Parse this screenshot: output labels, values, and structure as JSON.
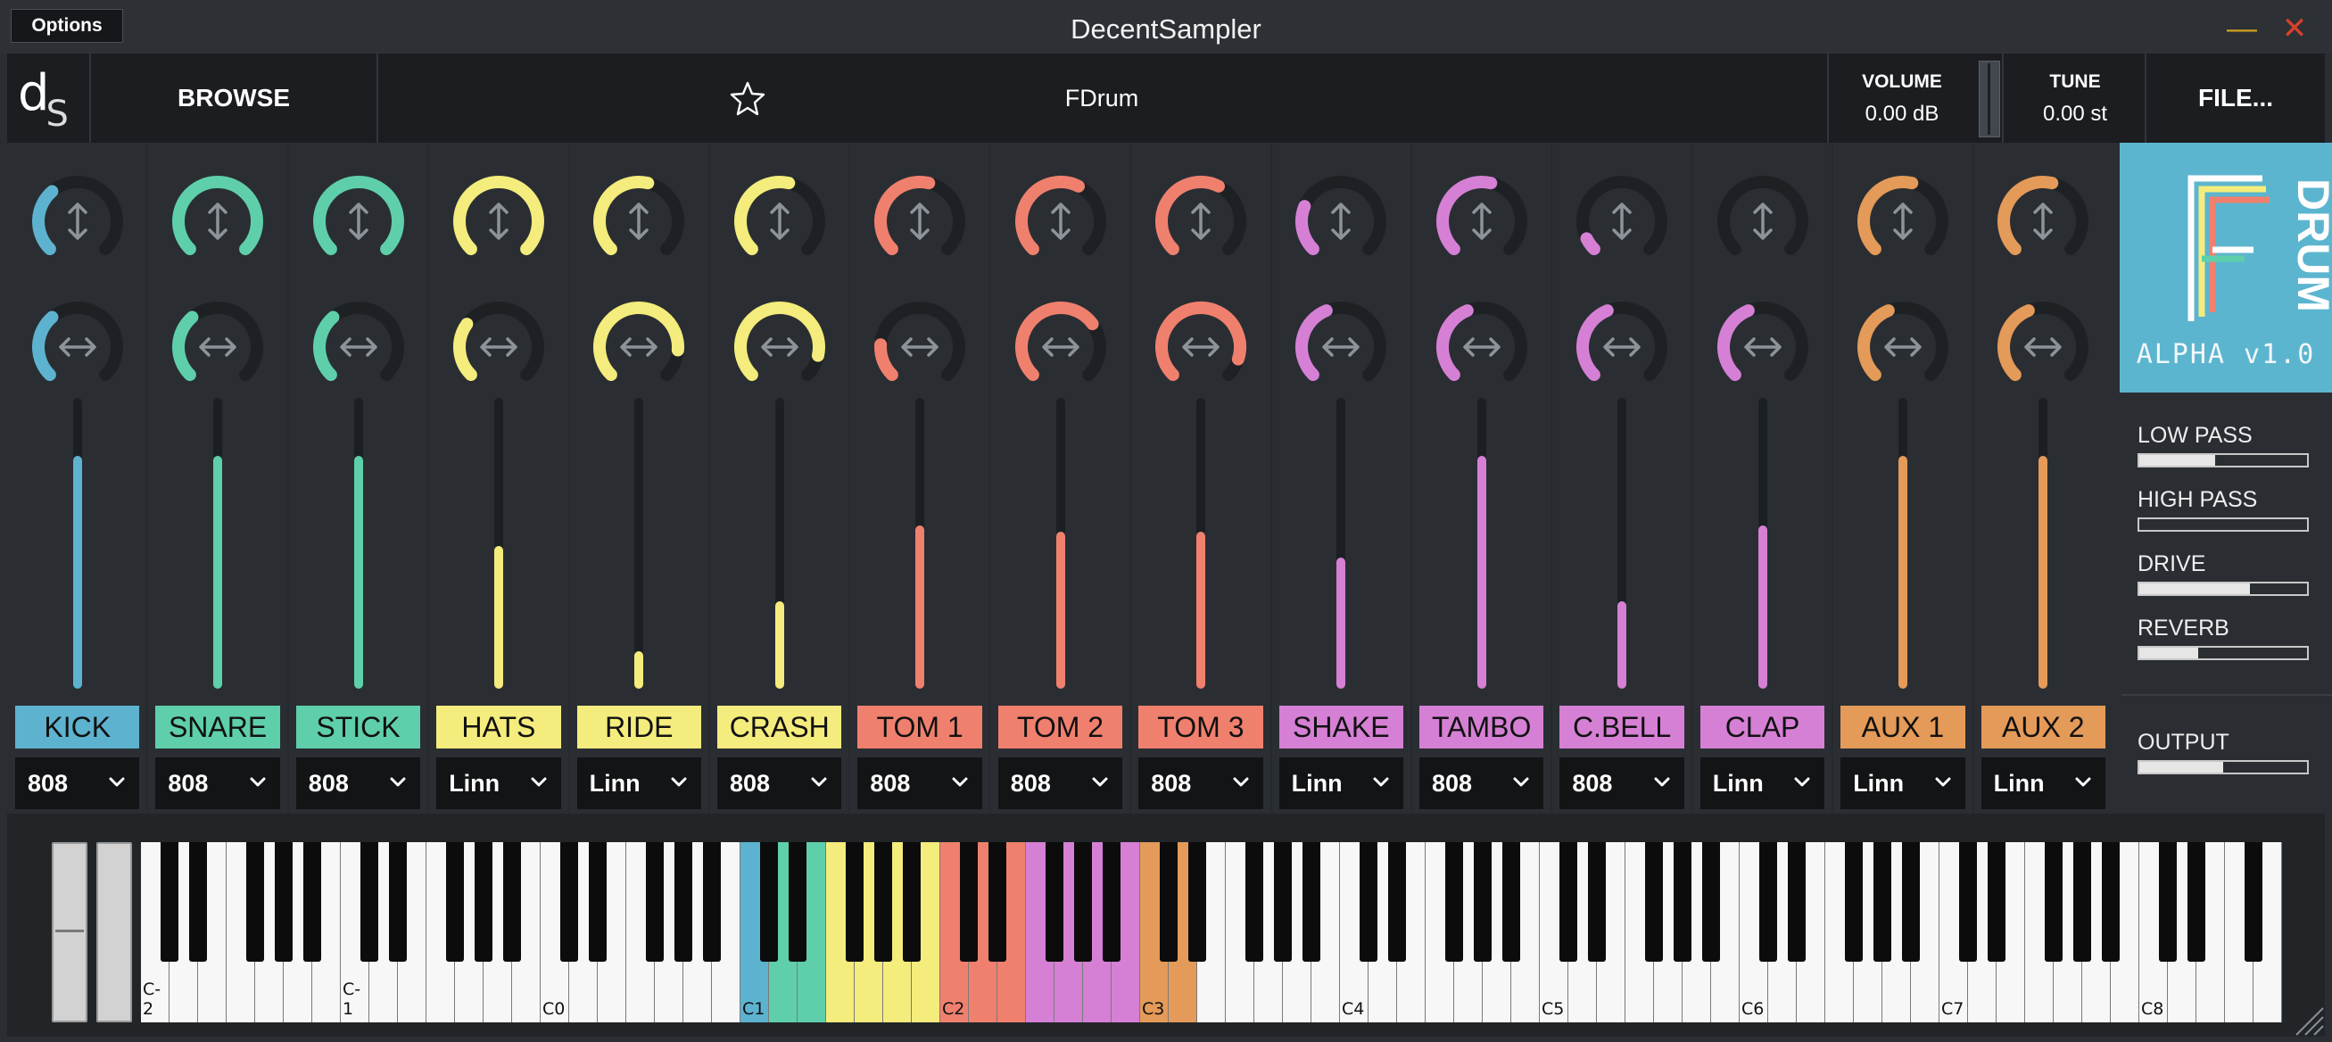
{
  "app": {
    "title": "DecentSampler",
    "options_label": "Options",
    "minimize_glyph": "—",
    "close_glyph": "✕"
  },
  "header": {
    "logo_d": "d",
    "logo_s": "S",
    "browse_label": "BROWSE",
    "preset_name": "FDrum",
    "volume_label": "VOLUME",
    "volume_value": "0.00 dB",
    "tune_label": "TUNE",
    "tune_value": "0.00 st",
    "file_label": "FILE..."
  },
  "colors": {
    "blue": "#5db3cf",
    "teal": "#5ecfaa",
    "yellow": "#f4ec7c",
    "salmon": "#f0806e",
    "purple": "#d580d5",
    "orange": "#e49a58"
  },
  "channels": [
    {
      "label": "KICK",
      "color": "#5db3cf",
      "select": "808",
      "tune": 0.35,
      "pan": 0.35,
      "level": 0.8
    },
    {
      "label": "SNARE",
      "color": "#5ecfaa",
      "select": "808",
      "tune": 1.0,
      "pan": 0.35,
      "level": 0.8
    },
    {
      "label": "STICK",
      "color": "#5ecfaa",
      "select": "808",
      "tune": 1.0,
      "pan": 0.35,
      "level": 0.8
    },
    {
      "label": "HATS",
      "color": "#f4ec7c",
      "select": "Linn",
      "tune": 1.0,
      "pan": 0.3,
      "level": 0.49
    },
    {
      "label": "RIDE",
      "color": "#f4ec7c",
      "select": "Linn",
      "tune": 0.55,
      "pan": 0.85,
      "level": 0.13
    },
    {
      "label": "CRASH",
      "color": "#f4ec7c",
      "select": "808",
      "tune": 0.55,
      "pan": 0.88,
      "level": 0.3
    },
    {
      "label": "TOM 1",
      "color": "#f0806e",
      "select": "808",
      "tune": 0.55,
      "pan": 0.18,
      "level": 0.56
    },
    {
      "label": "TOM 2",
      "color": "#f0806e",
      "select": "808",
      "tune": 0.6,
      "pan": 0.7,
      "level": 0.54
    },
    {
      "label": "TOM 3",
      "color": "#f0806e",
      "select": "808",
      "tune": 0.6,
      "pan": 0.9,
      "level": 0.54
    },
    {
      "label": "SHAKE",
      "color": "#d580d5",
      "select": "Linn",
      "tune": 0.25,
      "pan": 0.42,
      "level": 0.45
    },
    {
      "label": "TAMBO",
      "color": "#d580d5",
      "select": "808",
      "tune": 0.55,
      "pan": 0.42,
      "level": 0.8
    },
    {
      "label": "C.BELL",
      "color": "#d580d5",
      "select": "808",
      "tune": 0.07,
      "pan": 0.42,
      "level": 0.3
    },
    {
      "label": "CLAP",
      "color": "#d580d5",
      "select": "Linn",
      "tune": 0.0,
      "pan": 0.42,
      "level": 0.56
    },
    {
      "label": "AUX 1",
      "color": "#e49a58",
      "select": "Linn",
      "tune": 0.55,
      "pan": 0.42,
      "level": 0.8
    },
    {
      "label": "AUX 2",
      "color": "#e49a58",
      "select": "Linn",
      "tune": 0.55,
      "pan": 0.42,
      "level": 0.8
    }
  ],
  "fdrum_logo": {
    "letter_big": "F",
    "word": "DRUM",
    "version": "ALPHA v1.0"
  },
  "effects": [
    {
      "label": "LOW PASS",
      "value": 0.45
    },
    {
      "label": "HIGH PASS",
      "value": 0.0
    },
    {
      "label": "DRIVE",
      "value": 0.66
    },
    {
      "label": "REVERB",
      "value": 0.35
    }
  ],
  "output": {
    "label": "OUTPUT",
    "value": 0.5
  },
  "keyboard": {
    "octave_labels": [
      "C-2",
      "C-1",
      "C0",
      "C1",
      "C2",
      "C3",
      "C4",
      "C5",
      "C6",
      "C7",
      "C8"
    ],
    "first_octave": -2,
    "white_key_count": 75,
    "colored_notes": [
      {
        "midi": 36,
        "color": "#5db3cf"
      },
      {
        "midi": 37,
        "color": "#5ecfaa"
      },
      {
        "midi": 38,
        "color": "#5ecfaa"
      },
      {
        "midi": 39,
        "color": "#5ecfaa"
      },
      {
        "midi": 40,
        "color": "#5ecfaa"
      },
      {
        "midi": 41,
        "color": "#f4ec7c"
      },
      {
        "midi": 42,
        "color": "#f4ec7c"
      },
      {
        "midi": 43,
        "color": "#f4ec7c"
      },
      {
        "midi": 44,
        "color": "#f4ec7c"
      },
      {
        "midi": 45,
        "color": "#f4ec7c"
      },
      {
        "midi": 46,
        "color": "#f4ec7c"
      },
      {
        "midi": 47,
        "color": "#f4ec7c"
      },
      {
        "midi": 48,
        "color": "#f0806e"
      },
      {
        "midi": 49,
        "color": "#f0806e"
      },
      {
        "midi": 50,
        "color": "#f0806e"
      },
      {
        "midi": 51,
        "color": "#f0806e"
      },
      {
        "midi": 52,
        "color": "#f0806e"
      },
      {
        "midi": 53,
        "color": "#d580d5"
      },
      {
        "midi": 54,
        "color": "#d580d5"
      },
      {
        "midi": 55,
        "color": "#d580d5"
      },
      {
        "midi": 56,
        "color": "#d580d5"
      },
      {
        "midi": 57,
        "color": "#d580d5"
      },
      {
        "midi": 58,
        "color": "#d580d5"
      },
      {
        "midi": 59,
        "color": "#d580d5"
      },
      {
        "midi": 60,
        "color": "#e49a58"
      },
      {
        "midi": 61,
        "color": "#e49a58"
      },
      {
        "midi": 62,
        "color": "#e49a58"
      }
    ]
  },
  "icons": {
    "star": "star-icon",
    "tune": "vertical-arrows-icon",
    "pan": "horizontal-arrows-icon",
    "chevron": "chevron-down-icon",
    "resize": "resize-grip-icon"
  }
}
